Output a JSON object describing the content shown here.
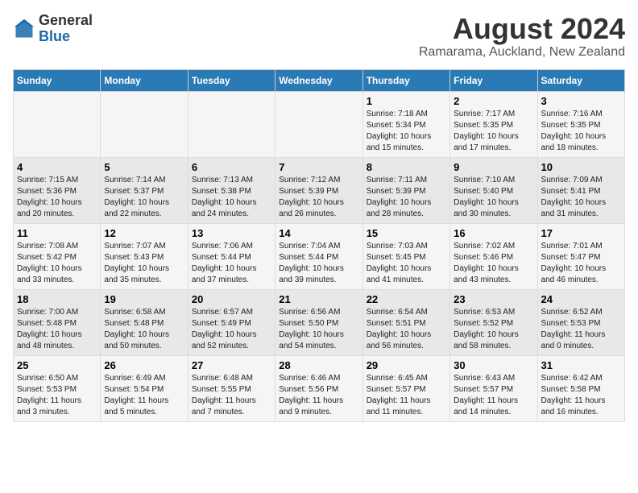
{
  "header": {
    "logo_general": "General",
    "logo_blue": "Blue",
    "main_title": "August 2024",
    "subtitle": "Ramarama, Auckland, New Zealand"
  },
  "days_of_week": [
    "Sunday",
    "Monday",
    "Tuesday",
    "Wednesday",
    "Thursday",
    "Friday",
    "Saturday"
  ],
  "weeks": [
    [
      {
        "day": "",
        "info": ""
      },
      {
        "day": "",
        "info": ""
      },
      {
        "day": "",
        "info": ""
      },
      {
        "day": "",
        "info": ""
      },
      {
        "day": "1",
        "info": "Sunrise: 7:18 AM\nSunset: 5:34 PM\nDaylight: 10 hours\nand 15 minutes."
      },
      {
        "day": "2",
        "info": "Sunrise: 7:17 AM\nSunset: 5:35 PM\nDaylight: 10 hours\nand 17 minutes."
      },
      {
        "day": "3",
        "info": "Sunrise: 7:16 AM\nSunset: 5:35 PM\nDaylight: 10 hours\nand 18 minutes."
      }
    ],
    [
      {
        "day": "4",
        "info": "Sunrise: 7:15 AM\nSunset: 5:36 PM\nDaylight: 10 hours\nand 20 minutes."
      },
      {
        "day": "5",
        "info": "Sunrise: 7:14 AM\nSunset: 5:37 PM\nDaylight: 10 hours\nand 22 minutes."
      },
      {
        "day": "6",
        "info": "Sunrise: 7:13 AM\nSunset: 5:38 PM\nDaylight: 10 hours\nand 24 minutes."
      },
      {
        "day": "7",
        "info": "Sunrise: 7:12 AM\nSunset: 5:39 PM\nDaylight: 10 hours\nand 26 minutes."
      },
      {
        "day": "8",
        "info": "Sunrise: 7:11 AM\nSunset: 5:39 PM\nDaylight: 10 hours\nand 28 minutes."
      },
      {
        "day": "9",
        "info": "Sunrise: 7:10 AM\nSunset: 5:40 PM\nDaylight: 10 hours\nand 30 minutes."
      },
      {
        "day": "10",
        "info": "Sunrise: 7:09 AM\nSunset: 5:41 PM\nDaylight: 10 hours\nand 31 minutes."
      }
    ],
    [
      {
        "day": "11",
        "info": "Sunrise: 7:08 AM\nSunset: 5:42 PM\nDaylight: 10 hours\nand 33 minutes."
      },
      {
        "day": "12",
        "info": "Sunrise: 7:07 AM\nSunset: 5:43 PM\nDaylight: 10 hours\nand 35 minutes."
      },
      {
        "day": "13",
        "info": "Sunrise: 7:06 AM\nSunset: 5:44 PM\nDaylight: 10 hours\nand 37 minutes."
      },
      {
        "day": "14",
        "info": "Sunrise: 7:04 AM\nSunset: 5:44 PM\nDaylight: 10 hours\nand 39 minutes."
      },
      {
        "day": "15",
        "info": "Sunrise: 7:03 AM\nSunset: 5:45 PM\nDaylight: 10 hours\nand 41 minutes."
      },
      {
        "day": "16",
        "info": "Sunrise: 7:02 AM\nSunset: 5:46 PM\nDaylight: 10 hours\nand 43 minutes."
      },
      {
        "day": "17",
        "info": "Sunrise: 7:01 AM\nSunset: 5:47 PM\nDaylight: 10 hours\nand 46 minutes."
      }
    ],
    [
      {
        "day": "18",
        "info": "Sunrise: 7:00 AM\nSunset: 5:48 PM\nDaylight: 10 hours\nand 48 minutes."
      },
      {
        "day": "19",
        "info": "Sunrise: 6:58 AM\nSunset: 5:48 PM\nDaylight: 10 hours\nand 50 minutes."
      },
      {
        "day": "20",
        "info": "Sunrise: 6:57 AM\nSunset: 5:49 PM\nDaylight: 10 hours\nand 52 minutes."
      },
      {
        "day": "21",
        "info": "Sunrise: 6:56 AM\nSunset: 5:50 PM\nDaylight: 10 hours\nand 54 minutes."
      },
      {
        "day": "22",
        "info": "Sunrise: 6:54 AM\nSunset: 5:51 PM\nDaylight: 10 hours\nand 56 minutes."
      },
      {
        "day": "23",
        "info": "Sunrise: 6:53 AM\nSunset: 5:52 PM\nDaylight: 10 hours\nand 58 minutes."
      },
      {
        "day": "24",
        "info": "Sunrise: 6:52 AM\nSunset: 5:53 PM\nDaylight: 11 hours\nand 0 minutes."
      }
    ],
    [
      {
        "day": "25",
        "info": "Sunrise: 6:50 AM\nSunset: 5:53 PM\nDaylight: 11 hours\nand 3 minutes."
      },
      {
        "day": "26",
        "info": "Sunrise: 6:49 AM\nSunset: 5:54 PM\nDaylight: 11 hours\nand 5 minutes."
      },
      {
        "day": "27",
        "info": "Sunrise: 6:48 AM\nSunset: 5:55 PM\nDaylight: 11 hours\nand 7 minutes."
      },
      {
        "day": "28",
        "info": "Sunrise: 6:46 AM\nSunset: 5:56 PM\nDaylight: 11 hours\nand 9 minutes."
      },
      {
        "day": "29",
        "info": "Sunrise: 6:45 AM\nSunset: 5:57 PM\nDaylight: 11 hours\nand 11 minutes."
      },
      {
        "day": "30",
        "info": "Sunrise: 6:43 AM\nSunset: 5:57 PM\nDaylight: 11 hours\nand 14 minutes."
      },
      {
        "day": "31",
        "info": "Sunrise: 6:42 AM\nSunset: 5:58 PM\nDaylight: 11 hours\nand 16 minutes."
      }
    ]
  ]
}
